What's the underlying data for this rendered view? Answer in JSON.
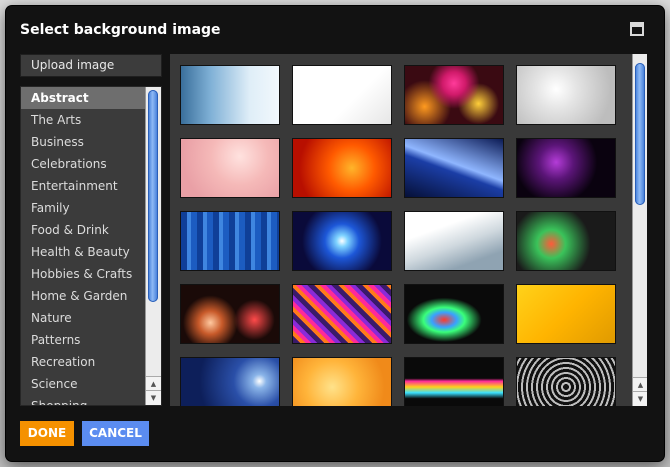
{
  "dialog": {
    "title": "Select background image",
    "upload_label": "Upload image",
    "done_label": "DONE",
    "cancel_label": "CANCEL"
  },
  "categories": [
    {
      "label": "Abstract",
      "selected": true
    },
    {
      "label": "The Arts"
    },
    {
      "label": "Business"
    },
    {
      "label": "Celebrations"
    },
    {
      "label": "Entertainment"
    },
    {
      "label": "Family"
    },
    {
      "label": "Food & Drink"
    },
    {
      "label": "Health & Beauty"
    },
    {
      "label": "Hobbies & Crafts"
    },
    {
      "label": "Home & Garden"
    },
    {
      "label": "Nature"
    },
    {
      "label": "Patterns"
    },
    {
      "label": "Recreation"
    },
    {
      "label": "Science"
    },
    {
      "label": "Shopping"
    }
  ],
  "colors": {
    "done": "#f59100",
    "cancel": "#5b8cf0",
    "scroll_thumb": "#3a76d6",
    "dialog_bg": "#121212"
  },
  "icons": {
    "maximize": "maximize-icon",
    "scroll_up": "scroll-up-arrow-icon",
    "scroll_down": "scroll-down-arrow-icon"
  }
}
